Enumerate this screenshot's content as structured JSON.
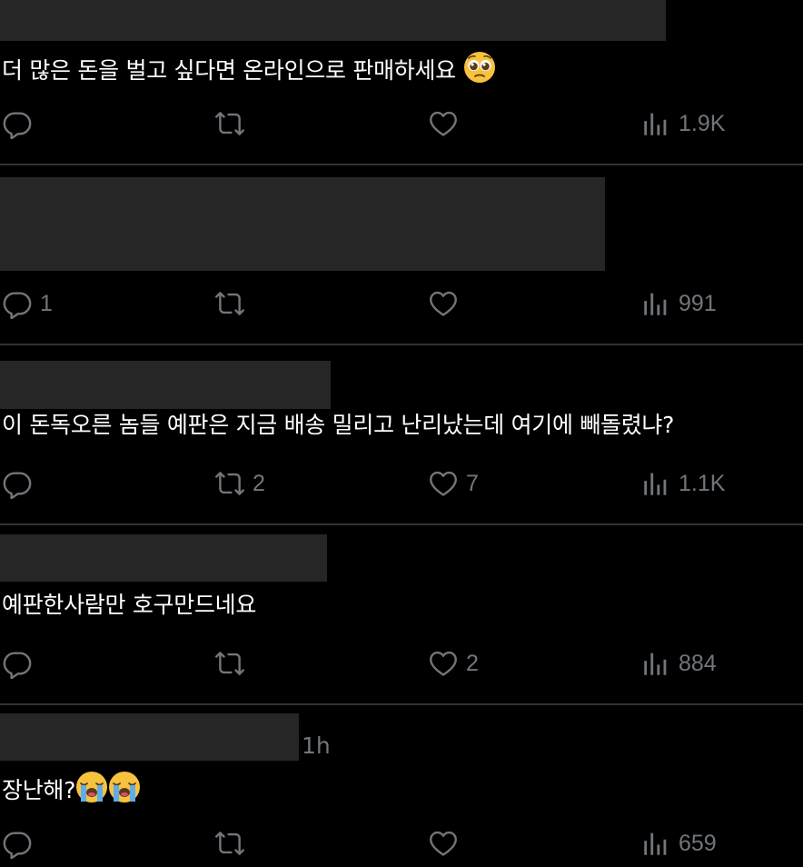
{
  "tweets": [
    {
      "text": "더 많은 돈을 벌고 싶다면 온라인으로 판매하세요",
      "emoji": "pleading-face",
      "reply": "",
      "retweet": "",
      "like": "",
      "views": "1.9K",
      "time": ""
    },
    {
      "text": "",
      "emoji": "",
      "reply": "1",
      "retweet": "",
      "like": "",
      "views": "991",
      "time": ""
    },
    {
      "text": "이 돈독오른 놈들 예판은 지금 배송 밀리고 난리났는데 여기에 빼돌렸냐?",
      "emoji": "",
      "reply": "",
      "retweet": "2",
      "like": "7",
      "views": "1.1K",
      "time": ""
    },
    {
      "text": "예판한사람만 호구만드네요",
      "emoji": "",
      "reply": "",
      "retweet": "",
      "like": "2",
      "views": "884",
      "time": ""
    },
    {
      "text": "장난해?",
      "emoji": "loudly-crying-face x2",
      "reply": "",
      "retweet": "",
      "like": "",
      "views": "659",
      "time": "1h"
    }
  ],
  "colors": {
    "background": "#000000",
    "text": "#e7e9ea",
    "muted": "#71767b",
    "redaction": "#262626",
    "separator": "#2f3336"
  }
}
